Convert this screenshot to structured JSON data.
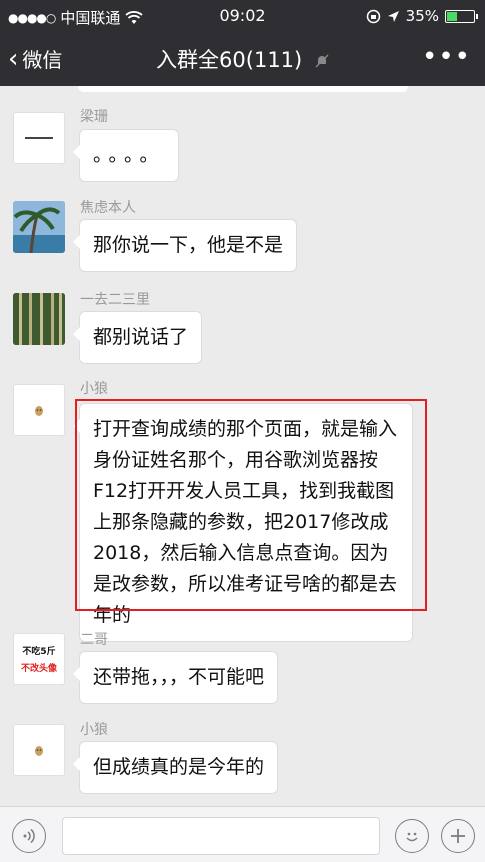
{
  "status_bar": {
    "carrier": "中国联通",
    "time": "09:02",
    "battery": "35%",
    "battery_level": 0.35
  },
  "nav": {
    "back_label": "微信",
    "title": "入群全60(111)",
    "more": "•••"
  },
  "messages": [
    {
      "sender": "梁珊",
      "text": "。。。。",
      "avatar": "white-sticker-avatar"
    },
    {
      "sender": "焦虑本人",
      "text": "那你说一下，他是不是",
      "avatar": "palm-tree-avatar"
    },
    {
      "sender": "一去二三里",
      "text": "都别说话了",
      "avatar": "forest-avatar"
    },
    {
      "sender": "小狼",
      "text": "打开查询成绩的那个页面，就是输入身份证姓名那个，用谷歌浏览器按F12打开开发人员工具，找到我截图上那条隐藏的参数，把2017修改成2018，然后输入信息点查询。因为是改参数，所以准考证号啥的都是去年的",
      "avatar": "wolf-avatar"
    },
    {
      "sender": "二哥",
      "text": "还带拖，，，不可能吧",
      "avatar": "text-sticker-avatar",
      "avatar_text_1": "不吃5斤",
      "avatar_text_2": "不改头像"
    },
    {
      "sender": "小狼",
      "text": "但成绩真的是今年的",
      "avatar": "wolf-avatar"
    }
  ],
  "colors": {
    "header_bg": "#2f2f33",
    "chat_bg": "#ebebeb",
    "highlight": "#e02020"
  }
}
